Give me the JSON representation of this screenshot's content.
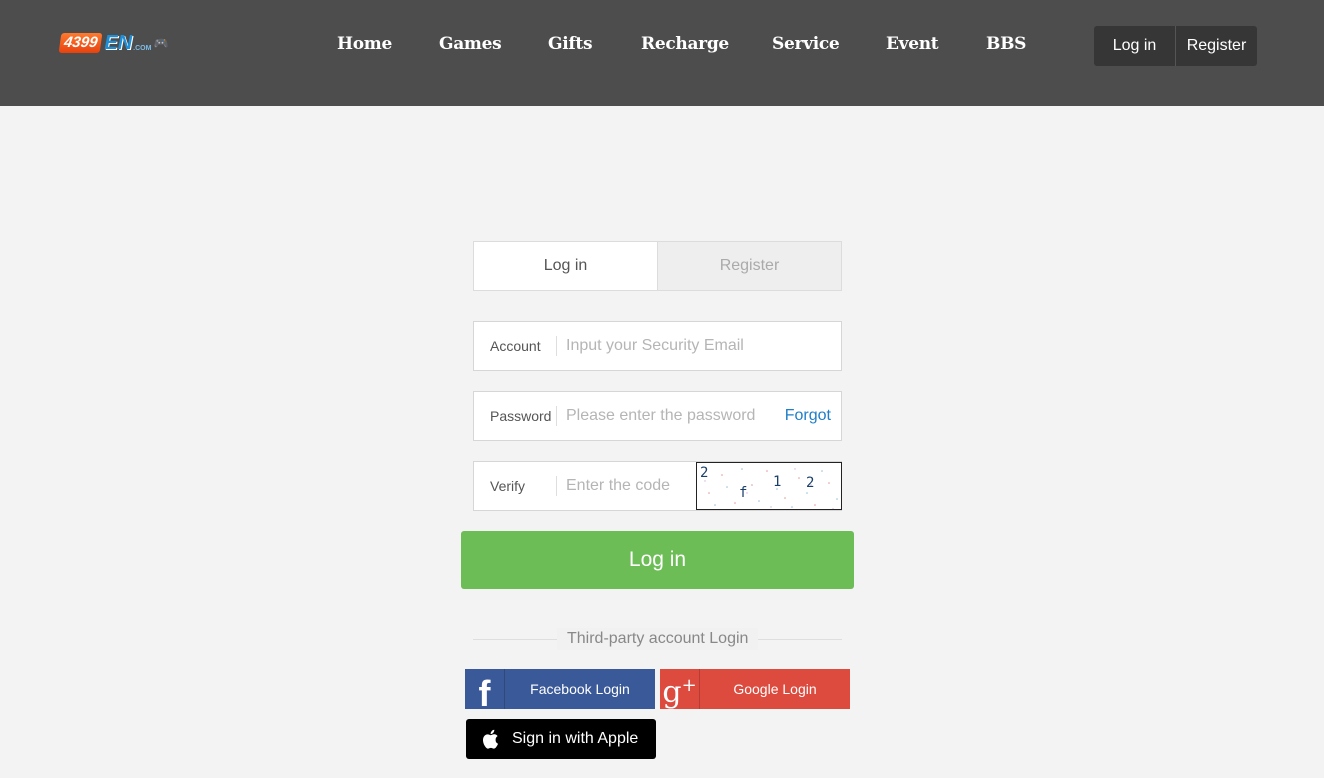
{
  "header": {
    "logo": {
      "main": "4399",
      "en": "EN",
      "com": ".COM"
    },
    "nav": [
      "Home",
      "Games",
      "Gifts",
      "Recharge",
      "Service",
      "Event",
      "BBS"
    ],
    "login_label": "Log in",
    "register_label": "Register"
  },
  "form": {
    "tabs": {
      "login": "Log in",
      "register": "Register"
    },
    "account": {
      "label": "Account",
      "placeholder": "Input your Security Email"
    },
    "password": {
      "label": "Password",
      "placeholder": "Please enter the password",
      "forgot": "Forgot"
    },
    "verify": {
      "label": "Verify",
      "placeholder": "Enter the code",
      "captcha_chars": [
        "2",
        "f",
        "1",
        "2"
      ]
    },
    "submit": "Log in"
  },
  "third_party": {
    "title": "Third-party account Login",
    "facebook": "Facebook Login",
    "google": "Google Login",
    "apple": "Sign in with Apple"
  },
  "colors": {
    "header_bg": "#4d4d4d",
    "login_green": "#6dbd56",
    "facebook_blue": "#3a5998",
    "google_red": "#dd4b3f",
    "link_blue": "#1e7ec8"
  },
  "icons": [
    "facebook-icon",
    "google-plus-icon",
    "apple-icon",
    "gamepad-icon"
  ]
}
